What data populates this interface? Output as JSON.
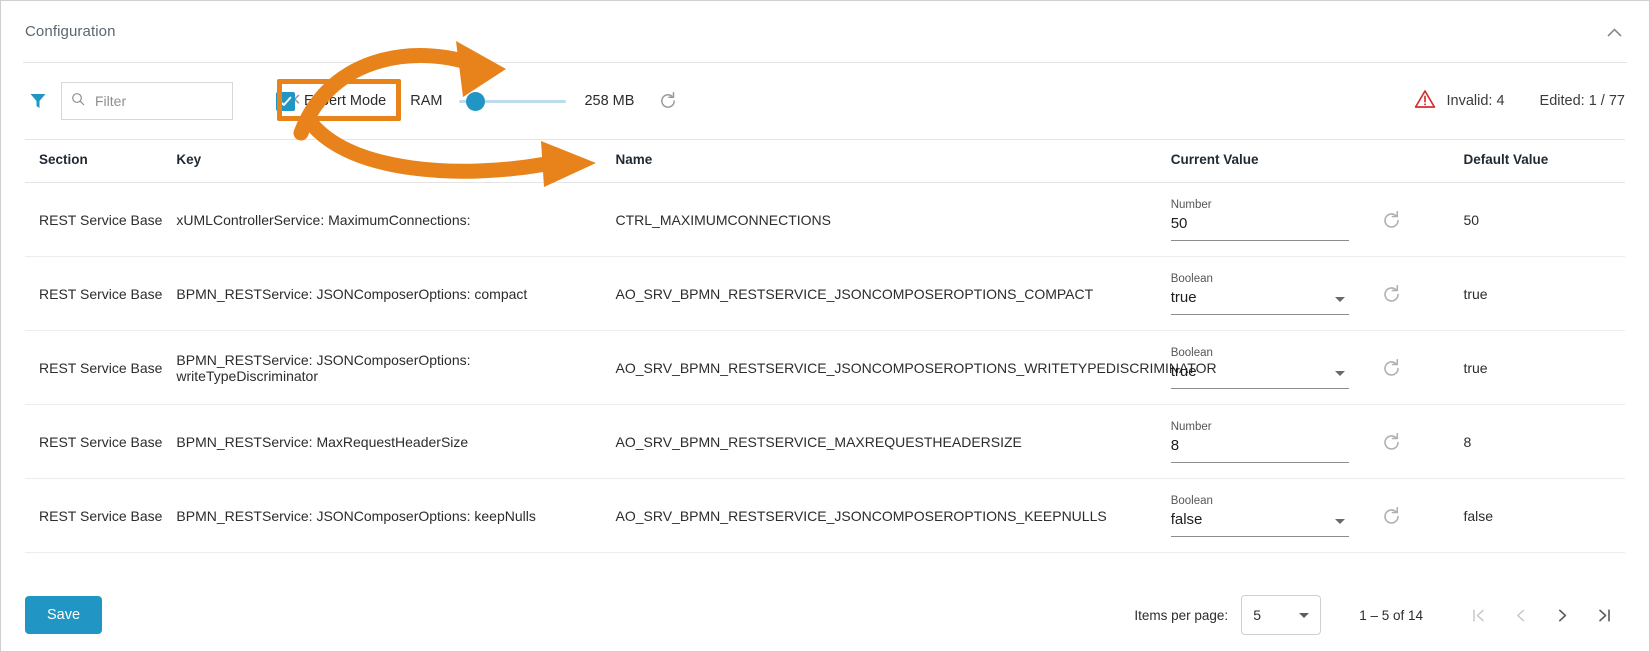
{
  "panel": {
    "title": "Configuration",
    "collapse_icon": "chevron-up-icon"
  },
  "toolbar": {
    "filter_icon": "funnel-icon",
    "search_icon": "search-icon",
    "filter_placeholder": "Filter",
    "filter_value": "",
    "clear_icon": "close-icon",
    "expert_mode_label": "Expert Mode",
    "expert_mode_checked": true,
    "ram_label": "RAM",
    "ram_value": "258 MB",
    "ram_slider_percent": 8,
    "ram_reset_icon": "refresh-icon",
    "invalid_icon": "warning-triangle-icon",
    "invalid_label": "Invalid: 4",
    "edited_label": "Edited: 1 / 77"
  },
  "table": {
    "columns": [
      "Section",
      "Key",
      "Name",
      "Current Value",
      "Default Value"
    ],
    "rows": [
      {
        "section": "REST Service Base",
        "key": "xUMLControllerService: MaximumConnections:",
        "name": "CTRL_MAXIMUMCONNECTIONS",
        "type_label": "Number",
        "current": "50",
        "has_dropdown": false,
        "reset_icon": "refresh-icon",
        "default": "50"
      },
      {
        "section": "REST Service Base",
        "key": "BPMN_RESTService: JSONComposerOptions: compact",
        "name": "AO_SRV_BPMN_RESTSERVICE_JSONCOMPOSEROPTIONS_COMPACT",
        "type_label": "Boolean",
        "current": "true",
        "has_dropdown": true,
        "reset_icon": "refresh-icon",
        "default": "true"
      },
      {
        "section": "REST Service Base",
        "key": "BPMN_RESTService: JSONComposerOptions: writeTypeDiscriminator",
        "name": "AO_SRV_BPMN_RESTSERVICE_JSONCOMPOSEROPTIONS_WRITETYPEDISCRIMINATOR",
        "type_label": "Boolean",
        "current": "true",
        "has_dropdown": true,
        "reset_icon": "refresh-icon",
        "default": "true"
      },
      {
        "section": "REST Service Base",
        "key": "BPMN_RESTService: MaxRequestHeaderSize",
        "name": "AO_SRV_BPMN_RESTSERVICE_MAXREQUESTHEADERSIZE",
        "type_label": "Number",
        "current": "8",
        "has_dropdown": false,
        "reset_icon": "refresh-icon",
        "default": "8"
      },
      {
        "section": "REST Service Base",
        "key": "BPMN_RESTService: JSONComposerOptions: keepNulls",
        "name": "AO_SRV_BPMN_RESTSERVICE_JSONCOMPOSEROPTIONS_KEEPNULLS",
        "type_label": "Boolean",
        "current": "false",
        "has_dropdown": true,
        "reset_icon": "refresh-icon",
        "default": "false"
      }
    ]
  },
  "footer": {
    "save_label": "Save",
    "items_per_page_label": "Items per page:",
    "items_per_page_value": "5",
    "range_label": "1 – 5 of 14",
    "first_page_icon": "first-page-icon",
    "prev_page_icon": "chevron-left-icon",
    "next_page_icon": "chevron-right-icon",
    "last_page_icon": "last-page-icon"
  },
  "colors": {
    "accent": "#2196c4",
    "annotation": "#E8821A",
    "invalid": "#d32f2f"
  }
}
